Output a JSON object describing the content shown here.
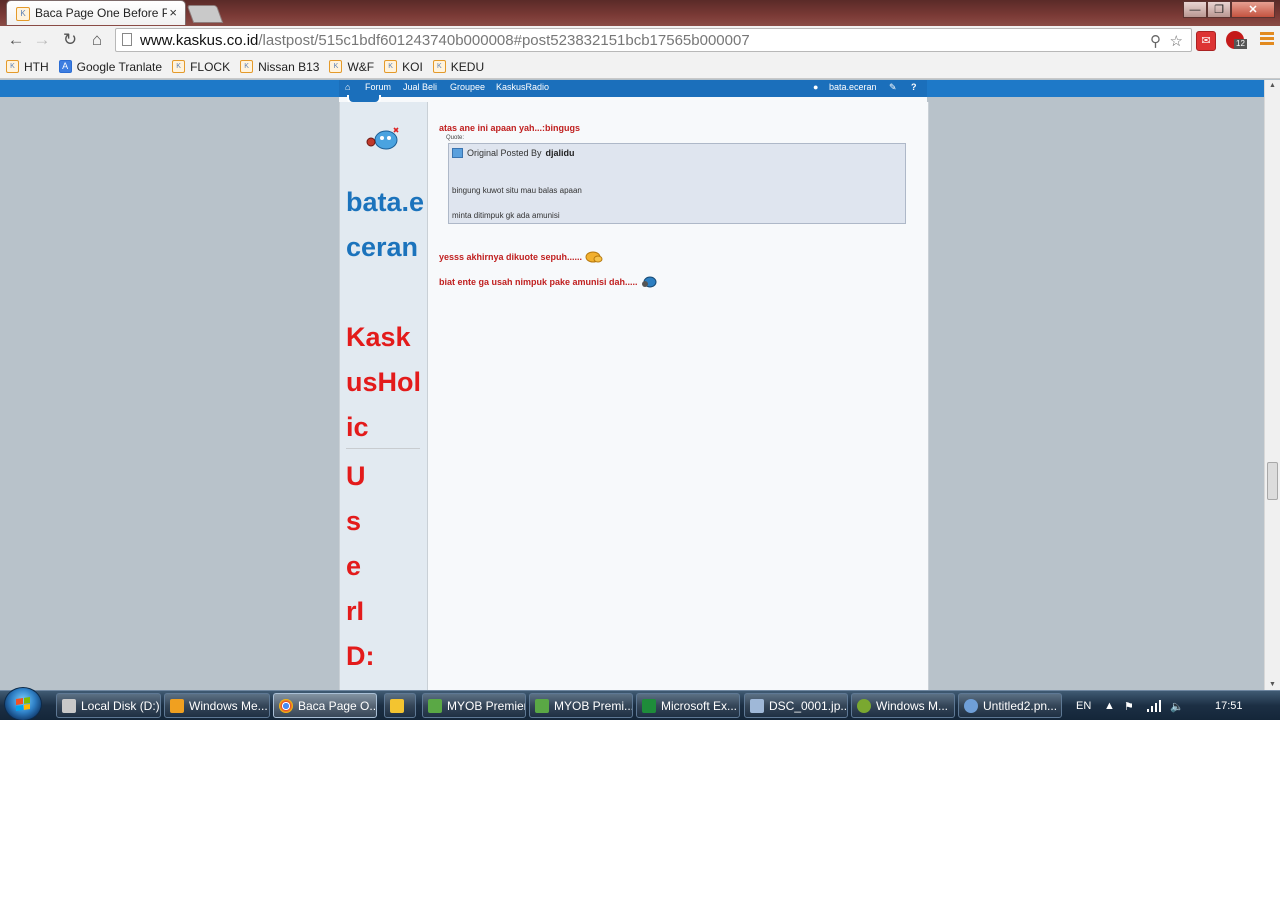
{
  "browser": {
    "tab_title": "Baca Page One Before Pos",
    "tab_close": "×",
    "address_host": "www.kaskus.co.id",
    "address_path": "/lastpost/515c1bdf601243740b000008#post523832151bcb17565b000007",
    "extension_badge": "12",
    "window_buttons": [
      "—",
      "❐",
      "✕"
    ]
  },
  "bookmarks": [
    {
      "label": "HTH",
      "icon": "kaskus-favicon"
    },
    {
      "label": "Google Tranlate",
      "icon": "google-translate-icon"
    },
    {
      "label": "FLOCK",
      "icon": "kaskus-favicon"
    },
    {
      "label": "Nissan B13",
      "icon": "kaskus-favicon"
    },
    {
      "label": "W&F",
      "icon": "kaskus-favicon"
    },
    {
      "label": "KOI",
      "icon": "kaskus-favicon"
    },
    {
      "label": "KEDU",
      "icon": "kaskus-favicon"
    }
  ],
  "kaskus_nav": {
    "items": [
      "Forum",
      "Jual Beli",
      "Groupee",
      "KaskusRadio"
    ],
    "username": "bata.eceran"
  },
  "user": {
    "name": "bata.eceran",
    "title": "KaskusHolic",
    "id_lines": [
      "U",
      "s",
      "e",
      "rI",
      "D:"
    ]
  },
  "post": {
    "line1": "atas ane ini apaan yah...:bingugs",
    "quote_label": "Quote:",
    "quote_header": "Original Posted By",
    "quote_author": "djalidu",
    "quote_line1": "bingung kuwot situ mau balas apaan",
    "quote_line2": "minta ditimpuk gk ada amunisi",
    "line2": "yesss akhirnya dikuote sepuh......",
    "line3": "biat ente ga usah nimpuk pake amunisi dah....."
  },
  "taskbar": {
    "items": [
      {
        "label": "Local Disk (D:)",
        "icon": "drive-icon",
        "color": "#c9c9c9"
      },
      {
        "label": "Windows Me...",
        "icon": "media-player-icon",
        "color": "#f0a020"
      },
      {
        "label": "Baca Page O...",
        "icon": "chrome-icon",
        "color": "#e0e0e0",
        "active": true
      },
      {
        "label": "",
        "icon": "outlook-icon",
        "color": "#f4c430"
      },
      {
        "label": "MYOB Premier",
        "icon": "myob-icon",
        "color": "#5aa845"
      },
      {
        "label": "MYOB Premi...",
        "icon": "myob-icon",
        "color": "#5aa845"
      },
      {
        "label": "Microsoft Ex...",
        "icon": "excel-icon",
        "color": "#1e8c3a"
      },
      {
        "label": "DSC_0001.jp...",
        "icon": "image-icon",
        "color": "#9fb8d8"
      },
      {
        "label": "Windows M...",
        "icon": "windows-media-icon",
        "color": "#7aa830"
      },
      {
        "label": "Untitled2.pn...",
        "icon": "paint-icon",
        "color": "#6f9fd8"
      }
    ],
    "language": "EN",
    "clock": "17:51"
  }
}
